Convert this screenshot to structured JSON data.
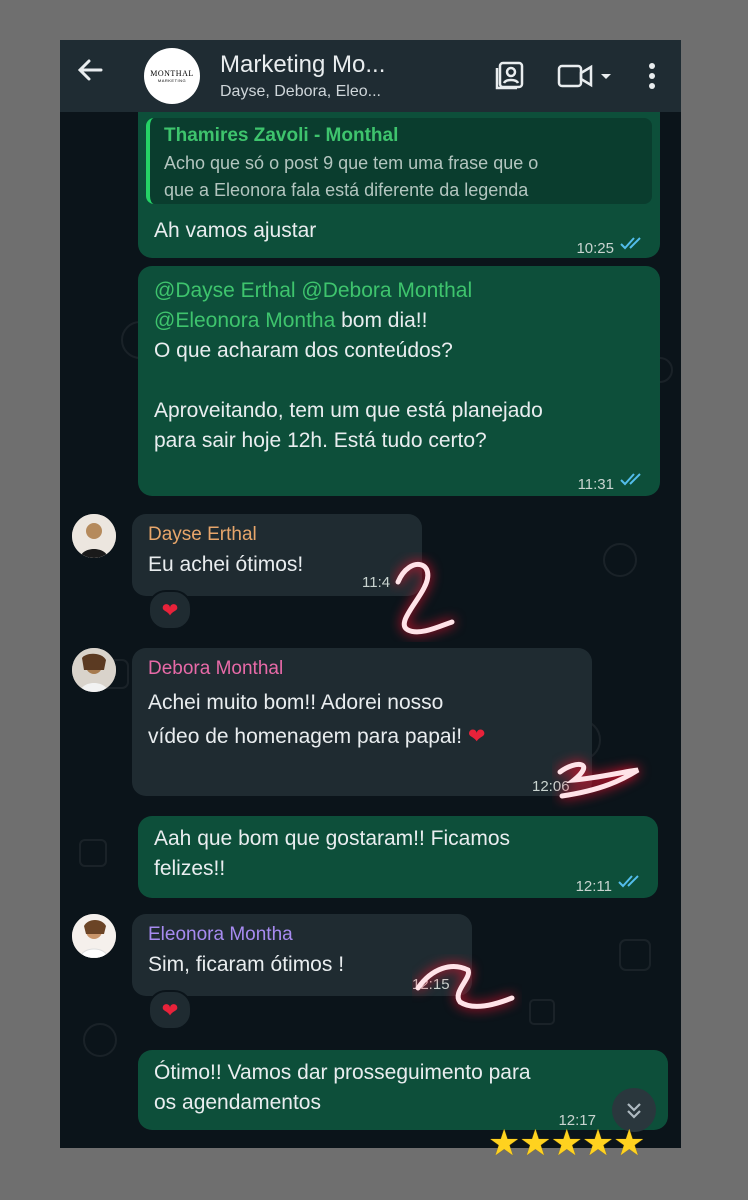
{
  "header": {
    "title": "Marketing Mo...",
    "subtitle": "Dayse, Debora, Eleo...",
    "avatar_brand": "MONTHAL",
    "avatar_sub": "MARKETING"
  },
  "messages": [
    {
      "type": "out",
      "quote_name": "Thamires Zavoli - Monthal",
      "quote_text_1": "Acho que só o post 9 que tem uma frase que o",
      "quote_text_2": "que a Eleonora fala está diferente da legenda",
      "text": "Ah vamos ajustar",
      "time": "10:25"
    },
    {
      "type": "out",
      "mention_1": "@Dayse Erthal",
      "mention_2": "@Debora Monthal",
      "mention_3": "@Eleonora Montha",
      "text_after_mention": " bom dia!!",
      "line_3": "O que acharam dos conteúdos?",
      "line_4": "Aproveitando, tem um que está planejado",
      "line_5": "para sair hoje 12h. Está tudo certo?",
      "time": "11:31"
    },
    {
      "type": "in",
      "sender": "Dayse Erthal",
      "sender_color": "#e7a66b",
      "text": "Eu achei ótimos!",
      "time": "11:4",
      "reaction": "❤"
    },
    {
      "type": "in",
      "sender": "Debora Monthal",
      "sender_color": "#e86aa8",
      "line_1": "Achei muito bom!! Adorei nosso",
      "line_2": "vídeo de homenagem para papai!",
      "emoji": "❤",
      "time": "12:06"
    },
    {
      "type": "out",
      "line_1": "Aah que bom que gostaram!! Ficamos",
      "line_2": "felizes!!",
      "time": "12:11"
    },
    {
      "type": "in",
      "sender": "Eleonora Montha",
      "sender_color": "#a78bf0",
      "text": "Sim, ficaram ótimos !",
      "time": "12:15",
      "reaction": "❤"
    },
    {
      "type": "out",
      "line_1": "Ótimo!! Vamos dar prosseguimento para",
      "line_2": "os agendamentos",
      "time": "12:17"
    }
  ],
  "stars": [
    "★",
    "★",
    "★",
    "★",
    "★"
  ],
  "colors": {
    "outgoing": "#0d4f3a",
    "incoming": "#1f2b31",
    "mention": "#3ec46d",
    "ticks": "#53bdeb"
  }
}
